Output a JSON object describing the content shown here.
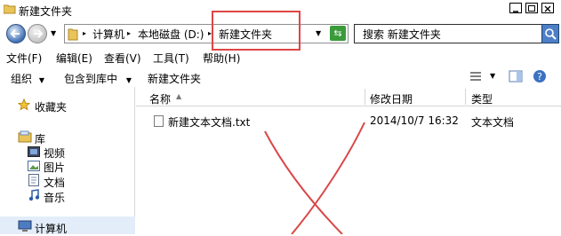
{
  "window": {
    "title": "新建文件夹"
  },
  "address": {
    "crumbs": [
      "计算机",
      "本地磁盘 (D:)",
      "新建文件夹"
    ],
    "search_placeholder": "搜索 新建文件夹"
  },
  "menu": {
    "items": [
      "文件(F)",
      "编辑(E)",
      "查看(V)",
      "工具(T)",
      "帮助(H)"
    ]
  },
  "toolbar": {
    "organize": "组织",
    "include": "包含到库中",
    "new_folder": "新建文件夹"
  },
  "nav": {
    "favorites": "收藏夹",
    "library": "库",
    "library_items": [
      "视频",
      "图片",
      "文档",
      "音乐"
    ],
    "computer": "计算机"
  },
  "columns": {
    "name": "名称",
    "modified": "修改日期",
    "type": "类型"
  },
  "files": [
    {
      "name": "新建文本文档.txt",
      "modified": "2014/10/7 16:32",
      "type": "文本文档"
    }
  ],
  "colors": {
    "annotation_red": "#e04545",
    "selection": "#e3edf9"
  }
}
